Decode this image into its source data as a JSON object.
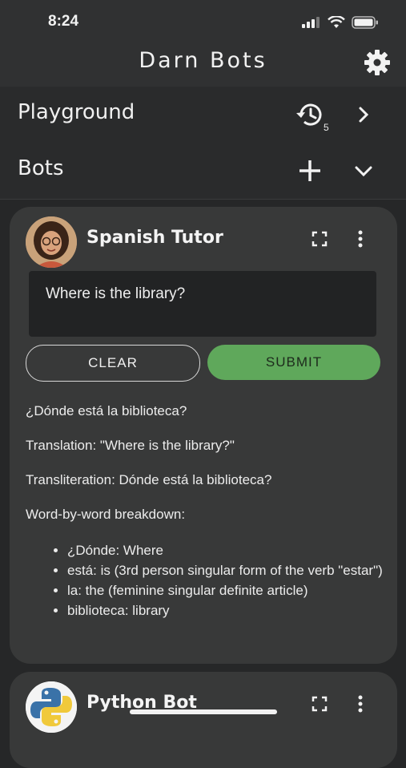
{
  "status_bar": {
    "time": "8:24"
  },
  "header": {
    "title": "Darn Bots",
    "settings_icon": "gear-icon"
  },
  "playground": {
    "label": "Playground",
    "history_count": "5"
  },
  "bots_section": {
    "label": "Bots"
  },
  "bot_card": {
    "name": "Spanish Tutor",
    "prompt": "Where is the library?",
    "clear_label": "CLEAR",
    "submit_label": "SUBMIT",
    "response": {
      "line1": "¿Dónde está la biblioteca?",
      "line2": "Translation: \"Where is the library?\"",
      "line3": "Transliteration: Dónde está la biblioteca?",
      "line4": "Word-by-word breakdown:",
      "bullets": [
        "¿Dónde: Where",
        "está: is (3rd person singular form of the verb \"estar\")",
        "la: the (feminine singular definite article)",
        "biblioteca: library"
      ]
    }
  },
  "bot_card_2": {
    "name": "Python Bot"
  },
  "colors": {
    "submit": "#5fa85b",
    "card": "#383939",
    "background": "#262728"
  }
}
